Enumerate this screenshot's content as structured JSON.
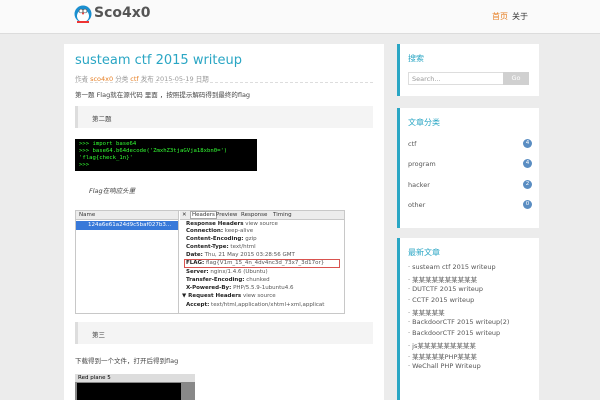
{
  "header": {
    "site_title": "Sco4x0",
    "nav": [
      "首页",
      "关于"
    ]
  },
  "post": {
    "title": "susteam ctf 2015 writeup",
    "meta": {
      "prefix": "作者",
      "author": "sco4x0",
      "cat_prefix": "分类",
      "category": "ctf",
      "date_prefix": "发布",
      "date": "2015-05-19",
      "suffix": "日期"
    },
    "intro": "第一题 Flag就在源代码 里面 ，按照提示解码得到最终的flag",
    "section1": "第二题",
    "terminal_lines": [
      ">>> import base64",
      ">>> base64.b64decode('ZmxhZ3tjaGVja18xbn0=')",
      "'flag{check_1n}'",
      ">>>"
    ],
    "hint": "Flag在响应头里",
    "devtools": {
      "col_name": "Name",
      "row": "124a6e61a24d9c5baf027b3...",
      "tabs": [
        "Headers",
        "Preview",
        "Response",
        "Timing"
      ],
      "headers": [
        {
          "k": "Response Headers",
          "v": "view source"
        },
        {
          "k": "Connection:",
          "v": "keep-alive"
        },
        {
          "k": "Content-Encoding:",
          "v": "gzip"
        },
        {
          "k": "Content-Type:",
          "v": "text/html"
        },
        {
          "k": "Date:",
          "v": "Thu, 21 May 2015 03:28:56 GMT"
        },
        {
          "k": "FLAG:",
          "v": "flag{V1m_15_4n_4dv4nc3d_73x7_3d17or}"
        },
        {
          "k": "Server:",
          "v": "nginx/1.4.6 (Ubuntu)"
        },
        {
          "k": "Transfer-Encoding:",
          "v": "chunked"
        },
        {
          "k": "X-Powered-By:",
          "v": "PHP/5.5.9-1ubuntu4.6"
        },
        {
          "k": "▼ Request Headers",
          "v": "view source"
        },
        {
          "k": "Accept:",
          "v": "text/html,application/xhtml+xml,applicat"
        }
      ]
    },
    "section2": "第三",
    "line2": "下载得到一个文件，打开后得到flag",
    "screen2_title": "Red plane 5"
  },
  "sidebar": {
    "search": {
      "title": "搜索",
      "placeholder": "Search...",
      "button": "Go"
    },
    "categories": {
      "title": "文章分类",
      "items": [
        {
          "name": "ctf",
          "count": "4"
        },
        {
          "name": "program",
          "count": "4"
        },
        {
          "name": "hacker",
          "count": "2"
        },
        {
          "name": "other",
          "count": "0"
        }
      ]
    },
    "recent": {
      "title": "最新文章",
      "items": [
        "susteam ctf 2015 writeup",
        "某某某某某某某某某某",
        "DUTCTF 2015 writeup",
        "CCTF 2015 writeup",
        "某某某某某",
        "BackdoorCTF 2015 writeup(2)",
        "BackdoorCTF 2015 writeup",
        "js某某某某某某某某某",
        "某某某某某PHP某某某",
        "WeChall PHP Writeup"
      ]
    }
  }
}
